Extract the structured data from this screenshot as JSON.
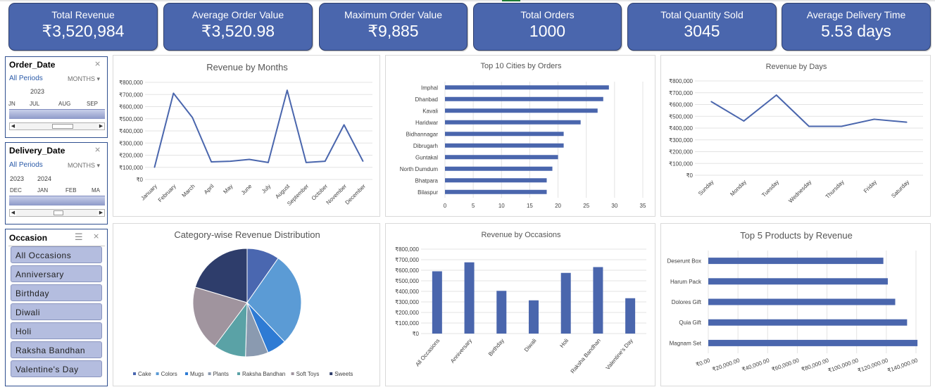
{
  "kpis": [
    {
      "label": "Total Revenue",
      "value": "₹3,520,984"
    },
    {
      "label": "Average Order Value",
      "value": "₹3,520.98"
    },
    {
      "label": "Maximum Order Value",
      "value": "₹9,885"
    },
    {
      "label": "Total Orders",
      "value": "1000"
    },
    {
      "label": "Total Quantity Sold",
      "value": "3045"
    },
    {
      "label": "Average Delivery Time",
      "value": "5.53 days"
    }
  ],
  "order_date_slicer": {
    "title": "Order_Date",
    "all_periods": "All Periods",
    "unit": "MONTHS",
    "years": [
      "2023"
    ],
    "months": [
      "JN",
      "JUL",
      "AUG",
      "SEP"
    ]
  },
  "delivery_date_slicer": {
    "title": "Delivery_Date",
    "all_periods": "All Periods",
    "unit": "MONTHS",
    "years": [
      "2023",
      "2024"
    ],
    "months": [
      "DEC",
      "JAN",
      "FEB",
      "MA"
    ]
  },
  "occasion_slicer": {
    "title": "Occasion",
    "items": [
      "All Occasions",
      "Anniversary",
      "Birthday",
      "Diwali",
      "Holi",
      "Raksha Bandhan",
      "Valentine's Day"
    ]
  },
  "colors": {
    "kpi_fill": "#4a66ad",
    "series": "#4a66ad",
    "pie": [
      "#4a67b0",
      "#5b9bd5",
      "#2e7bd4",
      "#8a9ab0",
      "#5aa2a6",
      "#a0949e",
      "#2e3d6b"
    ]
  },
  "chart_data": [
    {
      "id": "months",
      "type": "line",
      "title": "Revenue by Months",
      "categories": [
        "January",
        "February",
        "March",
        "April",
        "May",
        "June",
        "July",
        "August",
        "September",
        "October",
        "November",
        "December"
      ],
      "values": [
        100000,
        710000,
        510000,
        145000,
        150000,
        165000,
        140000,
        735000,
        140000,
        150000,
        450000,
        150000
      ],
      "ylim": [
        0,
        800000
      ],
      "yticks": [
        "₹0",
        "₹100,000",
        "₹200,000",
        "₹300,000",
        "₹400,000",
        "₹500,000",
        "₹600,000",
        "₹700,000",
        "₹800,000"
      ]
    },
    {
      "id": "cities",
      "type": "bar",
      "orientation": "horizontal",
      "title": "Top 10 Cities by Orders",
      "categories": [
        "Imphal",
        "Dhanbad",
        "Kavali",
        "Haridwar",
        "Bidhannagar",
        "Dibrugarh",
        "Guntakal",
        "North Dumdum",
        "Bhatpara",
        "Bilaspur"
      ],
      "values": [
        29,
        28,
        27,
        24,
        21,
        21,
        20,
        19,
        18,
        18
      ],
      "xlim": [
        0,
        35
      ],
      "xticks": [
        "0",
        "5",
        "10",
        "15",
        "20",
        "25",
        "30",
        "35"
      ]
    },
    {
      "id": "days",
      "type": "line",
      "title": "Revenue by Days",
      "categories": [
        "Sunday",
        "Monday",
        "Tuesday",
        "Wednesday",
        "Thursday",
        "Friday",
        "Saturday"
      ],
      "values": [
        625000,
        460000,
        680000,
        415000,
        415000,
        475000,
        450000
      ],
      "ylim": [
        0,
        800000
      ],
      "yticks": [
        "₹0",
        "₹100,000",
        "₹200,000",
        "₹300,000",
        "₹400,000",
        "₹500,000",
        "₹600,000",
        "₹700,000",
        "₹800,000"
      ]
    },
    {
      "id": "category",
      "type": "pie",
      "title": "Category-wise Revenue Distribution",
      "categories": [
        "Cake",
        "Colors",
        "Mugs",
        "Plants",
        "Raksha Bandhan",
        "Soft Toys",
        "Sweets"
      ],
      "values": [
        10,
        29,
        6,
        7,
        10,
        20,
        21
      ]
    },
    {
      "id": "occasions",
      "type": "bar",
      "orientation": "vertical",
      "title": "Revenue by Occasions",
      "categories": [
        "All Occasions",
        "Anniversary",
        "Birthday",
        "Diwali",
        "Holi",
        "Raksha Bandhan",
        "Valentine's Day"
      ],
      "values": [
        590000,
        675000,
        405000,
        315000,
        575000,
        630000,
        335000
      ],
      "ylim": [
        0,
        800000
      ],
      "yticks": [
        "₹0",
        "₹100,000",
        "₹200,000",
        "₹300,000",
        "₹400,000",
        "₹500,000",
        "₹600,000",
        "₹700,000",
        "₹800,000"
      ]
    },
    {
      "id": "products",
      "type": "bar",
      "orientation": "horizontal",
      "title": "Top 5 Products by Revenue",
      "categories": [
        "Deserunt Box",
        "Harum Pack",
        "Dolores Gift",
        "Quia Gift",
        "Magnam Set"
      ],
      "values": [
        118000,
        121000,
        126000,
        134000,
        141000
      ],
      "xlim": [
        0,
        140000
      ],
      "xticks": [
        "₹0.00",
        "₹20,000.00",
        "₹40,000.00",
        "₹60,000.00",
        "₹80,000.00",
        "₹100,000.00",
        "₹120,000.00",
        "₹140,000.00"
      ]
    }
  ]
}
